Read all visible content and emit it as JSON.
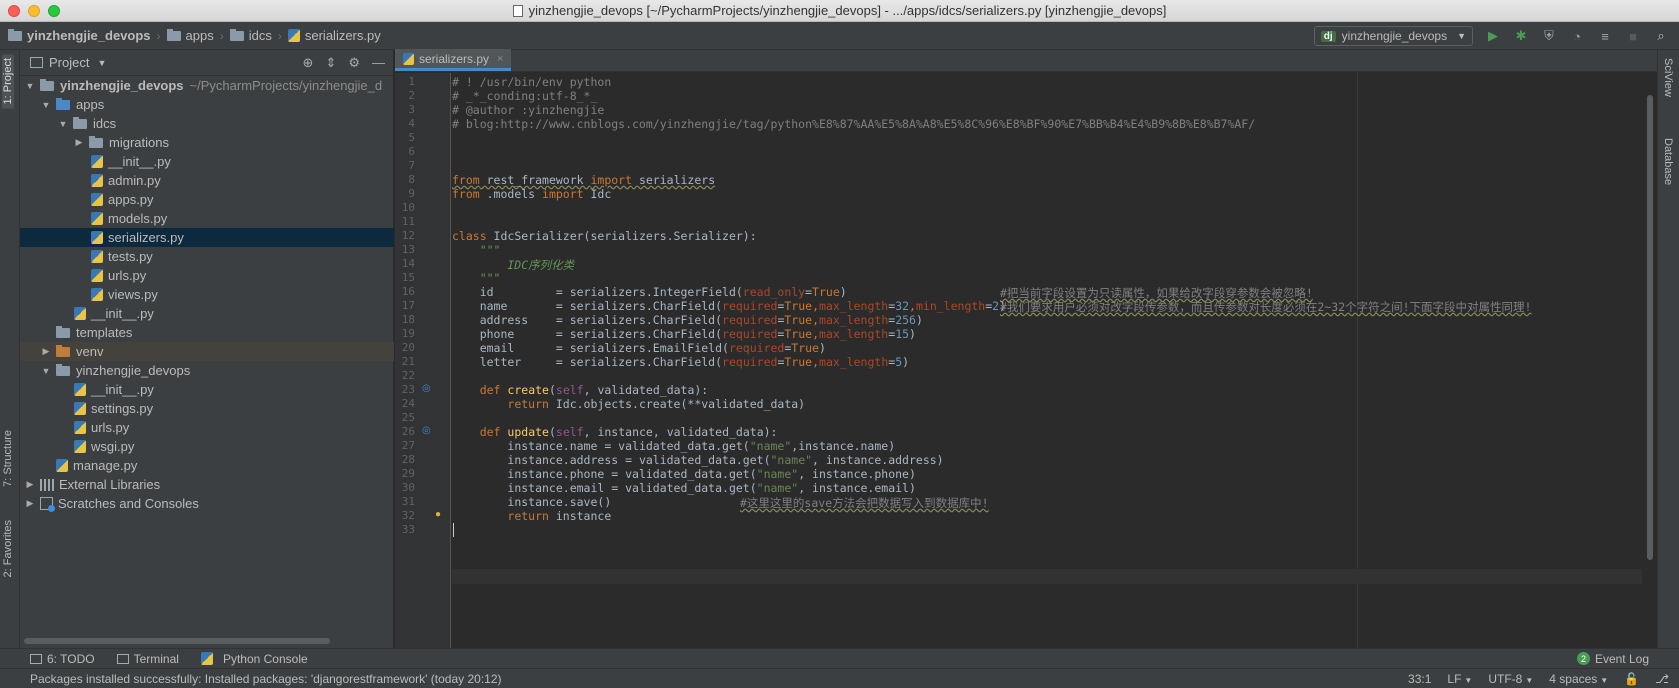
{
  "window": {
    "title": "yinzhengjie_devops [~/PycharmProjects/yinzhengjie_devops] - .../apps/idcs/serializers.py [yinzhengjie_devops]"
  },
  "breadcrumbs": [
    "yinzhengjie_devops",
    "apps",
    "idcs",
    "serializers.py"
  ],
  "run_config": {
    "badge": "dj",
    "label": "yinzhengjie_devops"
  },
  "left_stripe": {
    "project_tab": "1: Project",
    "structure_tab": "7: Structure",
    "favorites_tab": "2: Favorites"
  },
  "right_stripe": {
    "sciview_tab": "SciView",
    "database_tab": "Database"
  },
  "project_panel": {
    "title": "Project",
    "root_name": "yinzhengjie_devops",
    "root_path": "~/PycharmProjects/yinzhengjie_d",
    "nodes": {
      "apps": "apps",
      "idcs": "idcs",
      "migrations": "migrations",
      "idcs_init": "__init__.py",
      "admin": "admin.py",
      "apps_py": "apps.py",
      "models": "models.py",
      "serializers": "serializers.py",
      "tests": "tests.py",
      "urls": "urls.py",
      "views": "views.py",
      "apps_init": "__init__.py",
      "templates": "templates",
      "venv": "venv",
      "pkg": "yinzhengjie_devops",
      "pkg_init": "__init__.py",
      "settings": "settings.py",
      "pkg_urls": "urls.py",
      "wsgi": "wsgi.py",
      "manage": "manage.py",
      "external": "External Libraries",
      "scratches": "Scratches and Consoles"
    }
  },
  "editor": {
    "tab_label": "serializers.py",
    "line_numbers": [
      "1",
      "2",
      "3",
      "4",
      "5",
      "6",
      "7",
      "8",
      "9",
      "10",
      "11",
      "12",
      "13",
      "14",
      "15",
      "16",
      "17",
      "18",
      "19",
      "20",
      "21",
      "22",
      "23",
      "24",
      "25",
      "26",
      "27",
      "28",
      "29",
      "30",
      "31",
      "32",
      "33"
    ],
    "code": {
      "l1": "# ! /usr/bin/env python",
      "l2": "# _*_conding:utf-8_*_",
      "l3": "# @author :yinzhengjie",
      "l4": "# blog:http://www.cnblogs.com/yinzhengjie/tag/python%E8%87%AA%E5%8A%A8%E5%8C%96%E8%BF%90%E7%BB%B4%E4%B9%8B%E8%B7%AF/",
      "l8_from": "from",
      "l8_mod": " rest_framework ",
      "l8_import": "import",
      "l8_name": " serializers",
      "l9_from": "from",
      "l9_mod": " .models ",
      "l9_import": "import",
      "l9_name": " Idc",
      "l11_kw": "class",
      "l11_rest": " IdcSerializer(serializers.Serializer):",
      "l12": "    \"\"\"",
      "l13": "        IDC序列化类",
      "l14": "    \"\"\"",
      "l15_a": "    id",
      "l15_b": "         = serializers.IntegerField(",
      "l15_p": "read_only",
      "l15_c": "=",
      "l15_k": "True",
      "l15_d": ")",
      "l15_comment": "#把当前字段设置为只读属性，如果给改字段穿参数会被忽略!",
      "l16_a": "    name",
      "l16_b": "       = serializers.CharField(",
      "l16_p1": "required",
      "l16_k1": "True",
      "l16_p2": "max_length",
      "l16_n1": "32",
      "l16_p3": "min_length",
      "l16_n2": "2",
      "l16_comment": "#我们要求用户必须对改字段传参数，而且传参数对长度必须在2~32个字符之间!下面字段中对属性同理!",
      "l17_a": "    address",
      "l17_b": "    = serializers.CharField(",
      "l17_p1": "required",
      "l17_k1": "True",
      "l17_p2": "max_length",
      "l17_n1": "256",
      "l18_a": "    phone",
      "l18_b": "      = serializers.CharField(",
      "l18_p1": "required",
      "l18_k1": "True",
      "l18_p2": "max_length",
      "l18_n1": "15",
      "l19_a": "    email",
      "l19_b": "      = serializers.EmailField(",
      "l19_p1": "required",
      "l19_k1": "True",
      "l20_a": "    letter",
      "l20_b": "     = serializers.CharField(",
      "l20_p1": "required",
      "l20_k1": "True",
      "l20_p2": "max_length",
      "l20_n1": "5",
      "l23_kw": "def",
      "l23_fn": "create",
      "l23_self": "self",
      "l23_rest": ", validated_data):",
      "l24_kw": "return",
      "l24_rest": " Idc.objects.create(**validated_data)",
      "l26_kw": "def",
      "l26_fn": "update",
      "l26_self": "self",
      "l26_rest": ", instance, validated_data):",
      "l27_a": "instance.name = validated_data.get(",
      "l27_s": "\"name\"",
      "l27_b": ",instance.name)",
      "l28_a": "instance.address = validated_data.get(",
      "l28_s": "\"name\"",
      "l28_b": ", instance.address)",
      "l29_a": "instance.phone = validated_data.get(",
      "l29_s": "\"name\"",
      "l29_b": ", instance.phone)",
      "l30_a": "instance.email = validated_data.get(",
      "l30_s": "\"name\"",
      "l30_b": ", instance.email)",
      "l31_a": "instance.save()",
      "l31_comment": "#这里这里的save方法会把数据写入到数据库中!",
      "l32_kw": "return",
      "l32_rest": " instance"
    }
  },
  "bottom_tools": {
    "todo": "6: TODO",
    "terminal": "Terminal",
    "python_console": "Python Console",
    "event_log": "Event Log",
    "event_count": "2"
  },
  "status": {
    "message": "Packages installed successfully: Installed packages: 'djangorestframework' (today 20:12)",
    "position": "33:1",
    "line_sep": "LF",
    "encoding": "UTF-8",
    "indent": "4 spaces"
  },
  "colors": {
    "keyword": "#cc7832",
    "string": "#6a8759",
    "number": "#6897bb",
    "comment": "#808080",
    "param": "#aa4926",
    "selection": "#0d293e"
  }
}
